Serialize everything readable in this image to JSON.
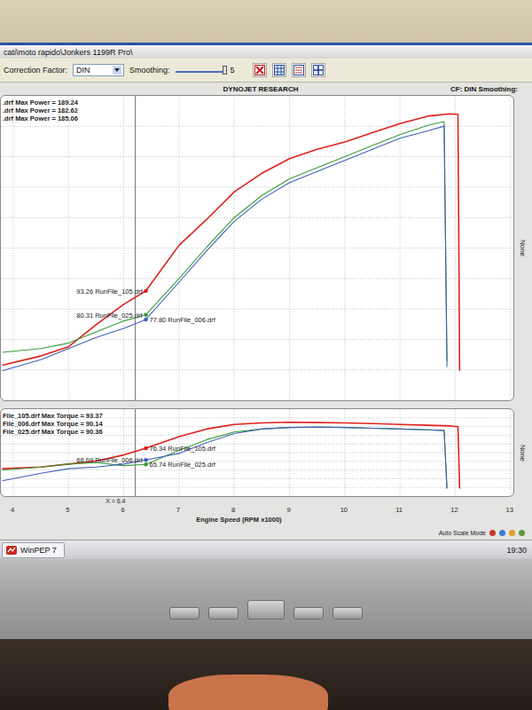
{
  "window": {
    "title": "cati\\moto rapido\\Jonkers 1199R Pro\\"
  },
  "toolbar": {
    "correction_label": "Correction Factor:",
    "correction_value": "DIN",
    "smoothing_label": "Smoothing:",
    "smoothing_value": "5",
    "smoothing_level": 1.0
  },
  "chart": {
    "header": "DYNOJET RESEARCH",
    "status": "CF: DIN  Smoothing:",
    "rpm_ticks": [
      "4",
      "5",
      "6",
      "7",
      "8",
      "9",
      "10",
      "11",
      "12",
      "13"
    ],
    "x_title": "Engine Speed (RPM x1000)",
    "cursor": {
      "label": "X = 6.4",
      "rpm": 6.4
    },
    "power": {
      "side_label": "None",
      "legend": [
        ".drf Max Power = 189.24",
        ".drf Max Power = 182.62",
        ".drf Max Power = 185.06"
      ],
      "series": [
        {
          "name": "RunFile_105.drf",
          "color": "#e0201c",
          "marker_label": "93.26 RunFile_105.drf",
          "rpm": [
            3.8,
            4.5,
            5.0,
            5.5,
            6.0,
            6.4,
            7.0,
            7.5,
            8.0,
            8.5,
            9.0,
            9.5,
            10.0,
            10.5,
            11.0,
            11.5,
            11.9,
            12.05,
            12.08
          ],
          "values": [
            53,
            58,
            63,
            75,
            86,
            93.26,
            118,
            132,
            147,
            157,
            165,
            170,
            174,
            179,
            184,
            188,
            189.24,
            189,
            50
          ]
        },
        {
          "name": "RunFile_025.drf",
          "color": "#3a9a3a",
          "marker_label": "80.31 RunFile_025.drf",
          "rpm": [
            3.8,
            4.5,
            5.0,
            5.5,
            6.0,
            6.4,
            7.0,
            7.5,
            8.0,
            8.5,
            9.0,
            9.5,
            10.0,
            10.5,
            11.0,
            11.5,
            11.8,
            11.85
          ],
          "values": [
            60,
            62,
            65,
            71,
            77,
            80.31,
            100,
            117,
            133,
            145,
            154,
            160,
            166,
            172,
            178,
            183,
            185.06,
            55
          ]
        },
        {
          "name": "RunFile_006.drf",
          "color": "#4060b8",
          "marker_label": "77.80 RunFile_006.drf",
          "rpm": [
            3.8,
            4.5,
            5.0,
            5.5,
            6.0,
            6.4,
            7.0,
            7.5,
            8.0,
            8.5,
            9.0,
            9.5,
            10.0,
            10.5,
            11.0,
            11.5,
            11.8,
            11.85
          ],
          "values": [
            50,
            56,
            62,
            68,
            73,
            77.8,
            98,
            115,
            131,
            143,
            152,
            158,
            164,
            170,
            176,
            180,
            182.62,
            52
          ]
        }
      ]
    },
    "torque": {
      "side_label": "None",
      "legend": [
        "File_105.drf Max Torque = 93.37",
        "File_006.drf Max Torque = 90.14",
        "File_025.drf Max Torque = 90.36"
      ],
      "series": [
        {
          "name": "RunFile_105.drf",
          "color": "#e0201c",
          "marker_label": "76.34 RunFile_105.drf",
          "rpm": [
            3.8,
            4.5,
            5.0,
            5.5,
            6.0,
            6.4,
            7.0,
            7.5,
            8.0,
            8.5,
            9.0,
            9.5,
            10.0,
            10.5,
            11.0,
            11.5,
            11.9,
            12.05,
            12.08
          ],
          "values": [
            63,
            64,
            66,
            68,
            72,
            76.34,
            84,
            89,
            92,
            93,
            93.37,
            93.2,
            93,
            92.5,
            92,
            91.5,
            91,
            90.5,
            50
          ]
        },
        {
          "name": "RunFile_025.drf",
          "color": "#3a9a3a",
          "marker_label": "65.74 RunFile_025.drf",
          "rpm": [
            3.8,
            4.5,
            5.0,
            5.5,
            6.0,
            6.4,
            7.0,
            7.5,
            8.0,
            8.5,
            9.0,
            9.5,
            10.0,
            10.5,
            11.0,
            11.5,
            11.8,
            11.85
          ],
          "values": [
            62,
            64,
            66,
            67,
            65,
            65.74,
            75,
            82,
            87,
            89,
            90,
            90.36,
            90,
            89.5,
            89,
            88.5,
            88,
            50
          ]
        },
        {
          "name": "RunFile_006.drf",
          "color": "#4060b8",
          "marker_label": "68.69 RunFile_006.drf",
          "rpm": [
            3.8,
            4.5,
            5.0,
            5.5,
            6.0,
            6.4,
            7.0,
            7.5,
            8.0,
            8.5,
            9.0,
            9.5,
            10.0,
            10.5,
            11.0,
            11.5,
            11.8,
            11.85
          ],
          "values": [
            55,
            60,
            63,
            64,
            66,
            68.69,
            73,
            80,
            86,
            89,
            90,
            90.14,
            90,
            89.5,
            89,
            88.5,
            88,
            50
          ]
        }
      ]
    }
  },
  "status_bar": {
    "mode": "Auto Scale Mode"
  },
  "taskbar": {
    "app": "WinPEP 7",
    "time": "19:30"
  }
}
